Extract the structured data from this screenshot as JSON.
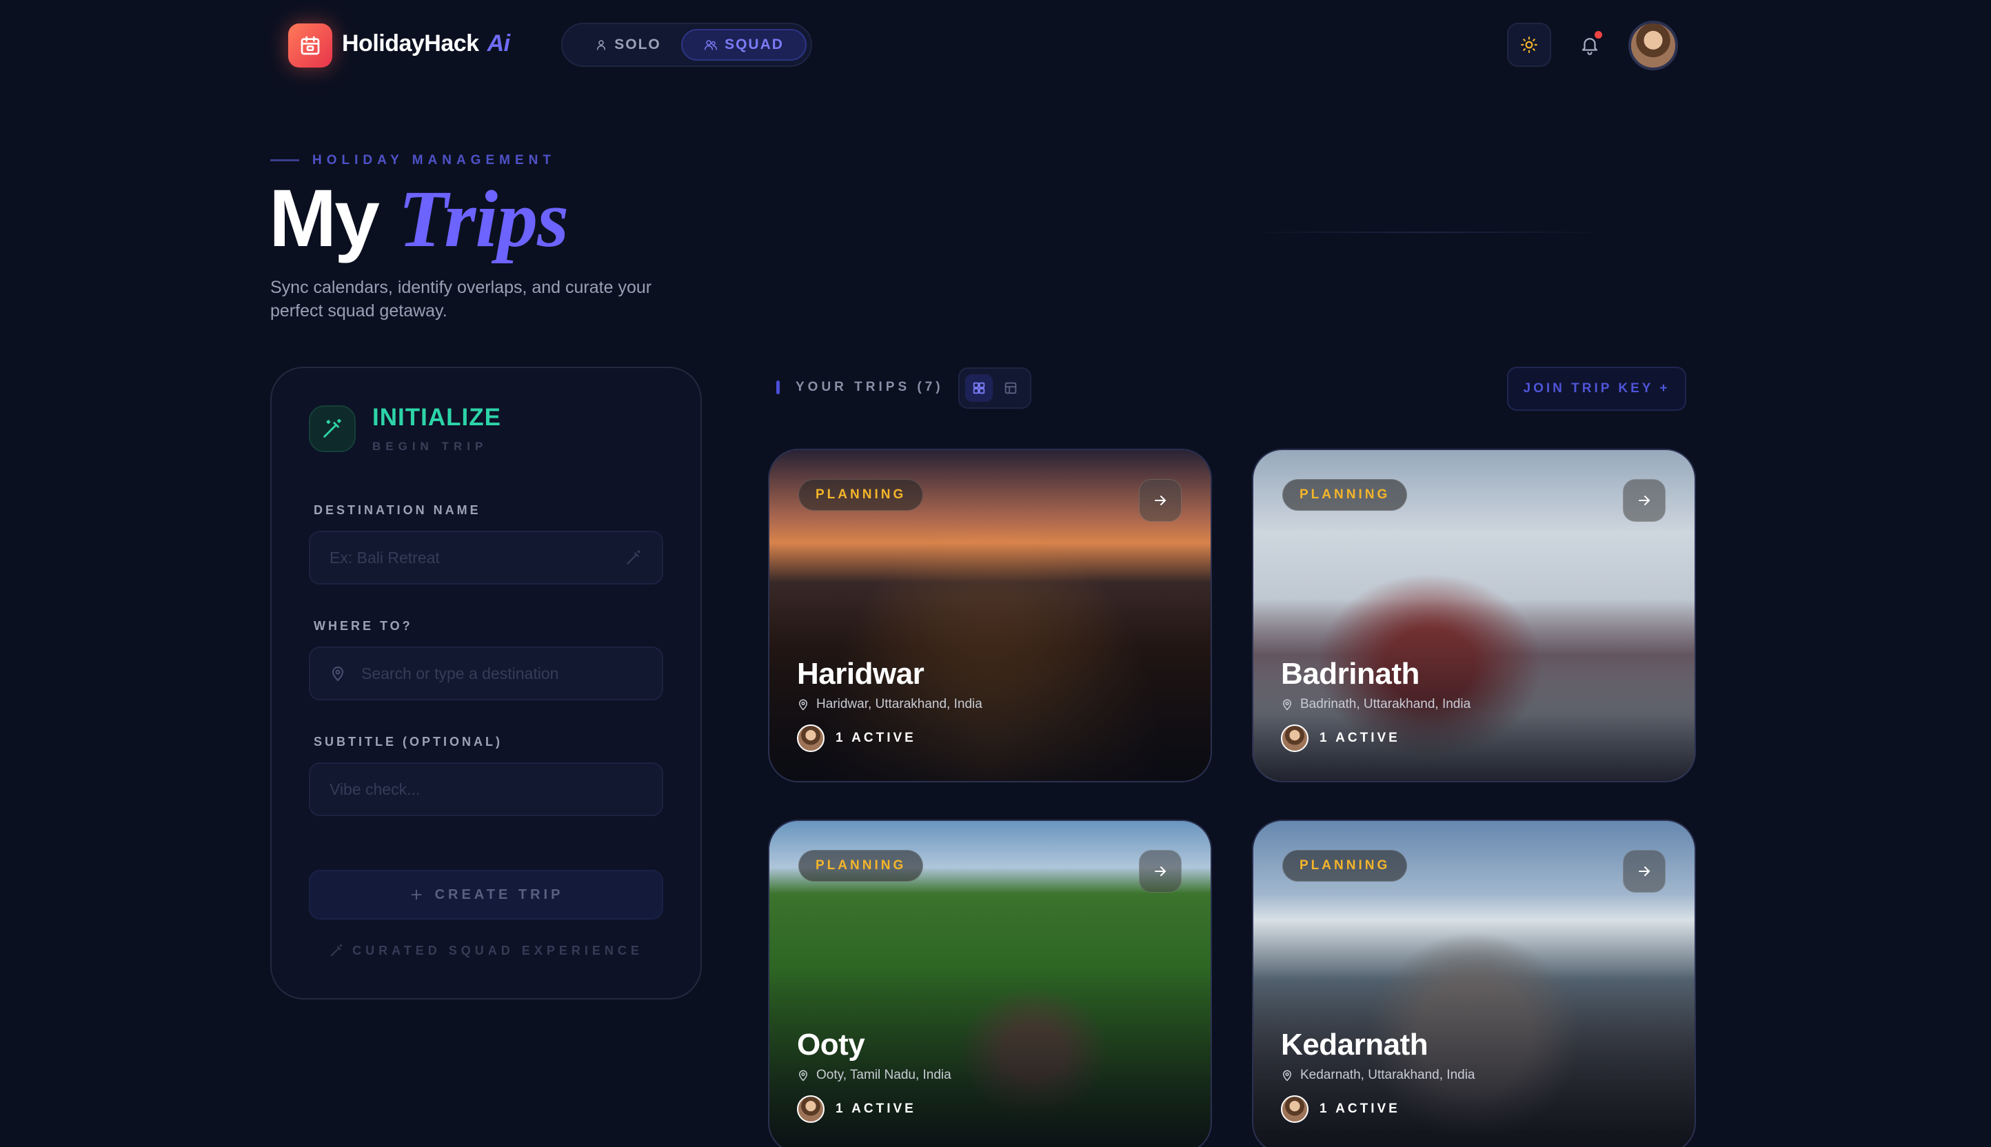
{
  "app": {
    "brand": "HolidayHack",
    "brand_ai": "Ai"
  },
  "header": {
    "modes": [
      {
        "label": "SOLO",
        "icon": "user-icon",
        "active": false
      },
      {
        "label": "SQUAD",
        "icon": "users-icon",
        "active": true
      }
    ],
    "notification_dot_color": "#ef4444"
  },
  "hero": {
    "eyebrow": "HOLIDAY MANAGEMENT",
    "title_main": "My",
    "title_accent": "Trips",
    "subtitle": "Sync calendars, identify overlaps, and curate your perfect squad getaway."
  },
  "init_panel": {
    "title": "INITIALIZE",
    "subtitle": "BEGIN TRIP",
    "fields": {
      "destination": {
        "label": "DESTINATION NAME",
        "placeholder": "Ex: Bali Retreat",
        "value": ""
      },
      "where": {
        "label": "WHERE TO?",
        "placeholder": "Search or type a destination",
        "value": ""
      },
      "subtitle": {
        "label": "SUBTITLE (OPTIONAL)",
        "placeholder": "Vibe check...",
        "value": ""
      }
    },
    "create_label": "CREATE TRIP",
    "curated_label": "CURATED SQUAD EXPERIENCE"
  },
  "trips": {
    "header_label": "YOUR TRIPS (7)",
    "join_label": "JOIN TRIP KEY +",
    "cards": [
      {
        "status": "PLANNING",
        "name": "Haridwar",
        "location": "Haridwar, Uttarakhand, India",
        "active": "1 ACTIVE"
      },
      {
        "status": "PLANNING",
        "name": "Badrinath",
        "location": "Badrinath, Uttarakhand, India",
        "active": "1 ACTIVE"
      },
      {
        "status": "PLANNING",
        "name": "Ooty",
        "location": "Ooty, Tamil Nadu, India",
        "active": "1 ACTIVE"
      },
      {
        "status": "PLANNING",
        "name": "Kedarnath",
        "location": "Kedarnath, Uttarakhand, India",
        "active": "1 ACTIVE"
      }
    ]
  },
  "colors": {
    "accent": "#6d63ff",
    "init": "#2dd4a8",
    "badge": "#f5b52a",
    "background": "#0b1020"
  }
}
